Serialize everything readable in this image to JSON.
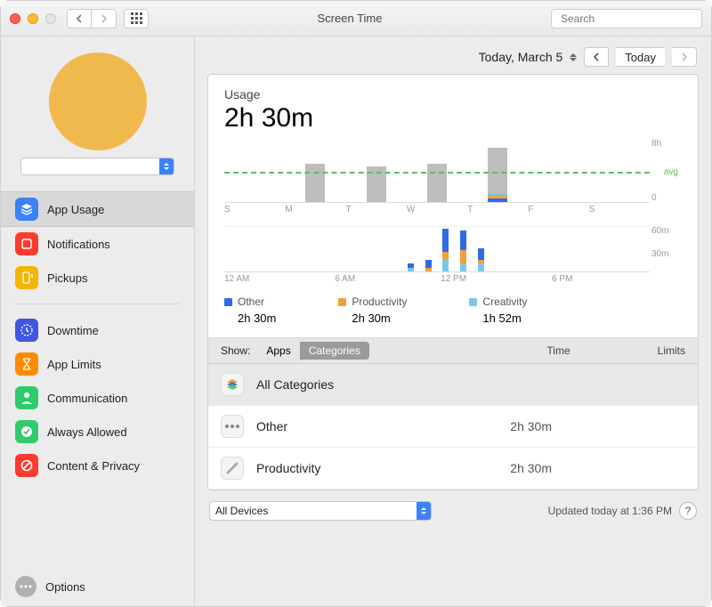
{
  "window": {
    "title": "Screen Time",
    "search_placeholder": "Search"
  },
  "sidebar": {
    "user_select": "",
    "groups": [
      {
        "items": [
          {
            "id": "app-usage",
            "label": "App Usage",
            "icon": "layers",
            "color": "#3b82f6",
            "selected": true
          },
          {
            "id": "notifications",
            "label": "Notifications",
            "icon": "bell",
            "color": "#ff3b30",
            "selected": false
          },
          {
            "id": "pickups",
            "label": "Pickups",
            "icon": "pickup",
            "color": "#f2b500",
            "selected": false
          }
        ]
      },
      {
        "items": [
          {
            "id": "downtime",
            "label": "Downtime",
            "icon": "clock",
            "color": "#4057e3",
            "selected": false
          },
          {
            "id": "app-limits",
            "label": "App Limits",
            "icon": "hourglass",
            "color": "#ff8a00",
            "selected": false
          },
          {
            "id": "communication",
            "label": "Communication",
            "icon": "person",
            "color": "#2fcb6b",
            "selected": false
          },
          {
            "id": "always-allowed",
            "label": "Always Allowed",
            "icon": "check",
            "color": "#2fcb6b",
            "selected": false
          },
          {
            "id": "content-privacy",
            "label": "Content & Privacy",
            "icon": "ban",
            "color": "#ff3b30",
            "selected": false
          }
        ]
      }
    ],
    "options_label": "Options"
  },
  "daterow": {
    "label": "Today, March 5",
    "today_label": "Today"
  },
  "usage": {
    "label": "Usage",
    "value": "2h 30m"
  },
  "chart_data": {
    "weekly": {
      "type": "bar",
      "title": "Usage",
      "ylabel": "",
      "ylim": [
        0,
        8
      ],
      "y_ticks": [
        "8h",
        "",
        "0"
      ],
      "avg_level": 0.48,
      "avg_label": "avg",
      "categories": [
        "S",
        "M",
        "T",
        "W",
        "T",
        "F",
        "S"
      ],
      "series": [
        {
          "name": "plain",
          "values": [
            0,
            4.8,
            4.5,
            4.8,
            5.6,
            0,
            0
          ],
          "color": "#bdbdbd"
        },
        {
          "name": "Creativity",
          "values": [
            0,
            0,
            0,
            0,
            0.25,
            0,
            0
          ],
          "color": "#7cc7ec"
        },
        {
          "name": "Productivity",
          "values": [
            0,
            0,
            0,
            0,
            0.4,
            0,
            0
          ],
          "color": "#f2a03c"
        },
        {
          "name": "Other",
          "values": [
            0,
            0,
            0,
            0,
            0.5,
            0,
            0
          ],
          "color": "#2e6be6"
        }
      ]
    },
    "hourly": {
      "type": "bar",
      "ylim": [
        0,
        60
      ],
      "y_ticks": [
        "60m",
        "30m",
        ""
      ],
      "x_ticks": [
        "12 AM",
        "6 AM",
        "12 PM",
        "6 PM"
      ],
      "series": [
        {
          "name": "Creativity",
          "color": "#7cc7ec",
          "values": [
            0,
            0,
            0,
            0,
            0,
            0,
            0,
            0,
            0,
            0,
            5,
            0,
            15,
            10,
            10,
            0,
            0,
            0,
            0,
            0,
            0,
            0,
            0,
            0
          ]
        },
        {
          "name": "Productivity",
          "color": "#f2a03c",
          "values": [
            0,
            0,
            0,
            0,
            0,
            0,
            0,
            0,
            0,
            0,
            0,
            5,
            10,
            18,
            5,
            0,
            0,
            0,
            0,
            0,
            0,
            0,
            0,
            0
          ]
        },
        {
          "name": "Other",
          "color": "#2e6be6",
          "values": [
            0,
            0,
            0,
            0,
            0,
            0,
            0,
            0,
            0,
            0,
            5,
            10,
            30,
            25,
            15,
            0,
            0,
            0,
            0,
            0,
            0,
            0,
            0,
            0
          ]
        }
      ]
    }
  },
  "legend": [
    {
      "swatch": "#2e6be6",
      "label": "Other",
      "value": "2h 30m"
    },
    {
      "swatch": "#f2a03c",
      "label": "Productivity",
      "value": "2h 30m"
    },
    {
      "swatch": "#7cc7ec",
      "label": "Creativity",
      "value": "1h 52m"
    }
  ],
  "table": {
    "show_label": "Show:",
    "tabs": [
      {
        "label": "Apps",
        "active": false
      },
      {
        "label": "Categories",
        "active": true
      }
    ],
    "col_time": "Time",
    "col_limits": "Limits",
    "rows": [
      {
        "icon": "stack",
        "label": "All Categories",
        "time": "",
        "selected": true
      },
      {
        "icon": "dots",
        "label": "Other",
        "time": "2h 30m",
        "selected": false
      },
      {
        "icon": "brush",
        "label": "Productivity",
        "time": "2h 30m",
        "selected": false
      }
    ]
  },
  "footer": {
    "devices": "All Devices",
    "updated": "Updated today at 1:36 PM"
  }
}
